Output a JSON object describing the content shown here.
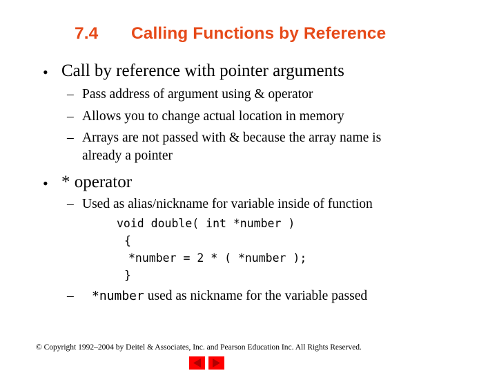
{
  "slide": {
    "title_number": "7.4",
    "title_text": "Calling Functions by Reference",
    "accent_color": "#e64a19",
    "bullets": [
      {
        "text": "Call by reference with pointer arguments",
        "subs": [
          "Pass address of argument using & operator",
          "Allows you to change actual location in memory",
          "Arrays are not passed with & because the array name is",
          "already a pointer"
        ]
      },
      {
        "text": "* operator",
        "subs": [
          "Used as alias/nickname for variable inside of function"
        ],
        "code": [
          "void double( int *number )",
          "{",
          "*number = 2 * ( *number );",
          "}"
        ],
        "last_sub_code": "*number",
        "last_sub_text": " used as nickname for the variable passed"
      }
    ],
    "footer": "© Copyright 1992–2004 by Deitel & Associates, Inc. and Pearson Education Inc. All Rights Reserved.",
    "nav": {
      "prev_icon": "previous-slide-icon",
      "next_icon": "next-slide-icon",
      "button_color": "#ff0000"
    }
  }
}
